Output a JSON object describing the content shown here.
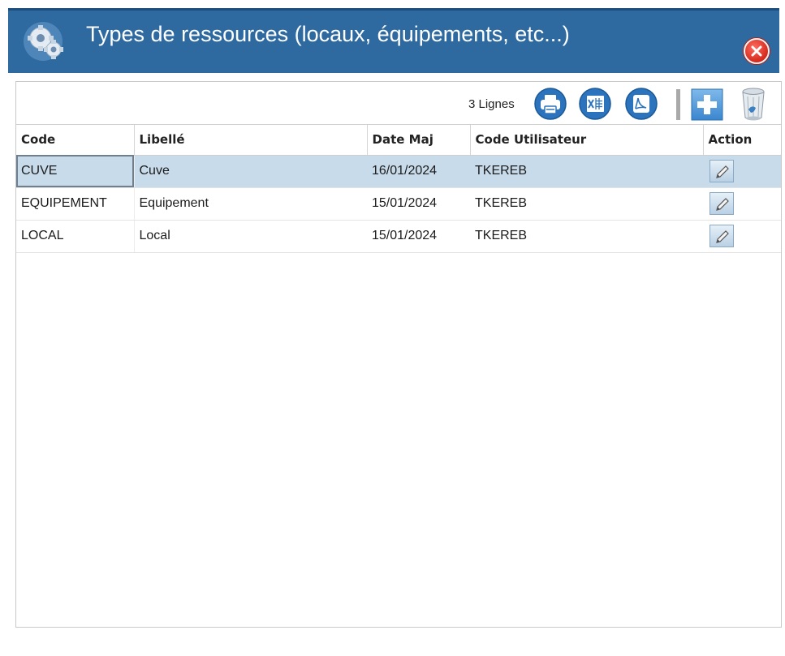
{
  "window": {
    "title": "Types de ressources (locaux, équipements, etc...)",
    "title_icon": "gears-icon",
    "close_icon": "close-icon",
    "colors": {
      "titlebar": "#2e6aa0",
      "close": "#d42a1d",
      "selected_row": "#c8dbea"
    }
  },
  "toolbar": {
    "row_count": "3 Lignes",
    "buttons": [
      {
        "name": "print-icon"
      },
      {
        "name": "excel-export-icon"
      },
      {
        "name": "pdf-export-icon"
      },
      {
        "name": "add-icon"
      },
      {
        "name": "trash-icon"
      }
    ]
  },
  "table": {
    "headers": [
      "Code",
      "Libellé",
      "Date Maj",
      "Code Utilisateur",
      "Action"
    ],
    "rows": [
      {
        "code": "CUVE",
        "libelle": "Cuve",
        "date_maj": "16/01/2024",
        "code_utilisateur": "TKEREB",
        "selected": true
      },
      {
        "code": "EQUIPEMENT",
        "libelle": "Equipement",
        "date_maj": "15/01/2024",
        "code_utilisateur": "TKEREB",
        "selected": false
      },
      {
        "code": "LOCAL",
        "libelle": "Local",
        "date_maj": "15/01/2024",
        "code_utilisateur": "TKEREB",
        "selected": false
      }
    ],
    "action_icon": "pencil-icon"
  }
}
